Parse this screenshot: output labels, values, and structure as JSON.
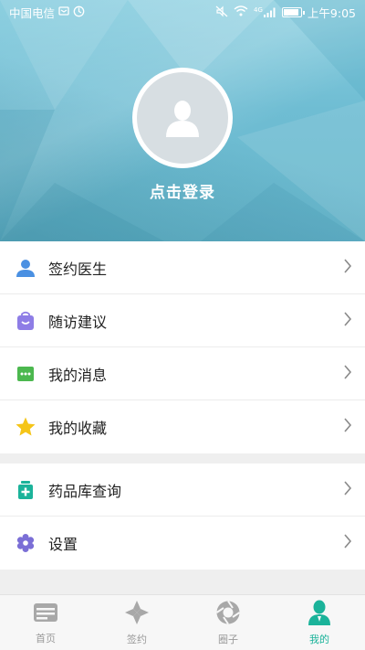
{
  "status_bar": {
    "carrier": "中国电信",
    "network": "4G",
    "time": "上午9:05"
  },
  "profile": {
    "avatar_icon": "user-silhouette-icon",
    "login_label": "点击登录"
  },
  "menu": {
    "group1": [
      {
        "label": "签约医生",
        "icon": "person-icon",
        "color": "#4a90e2"
      },
      {
        "label": "随访建议",
        "icon": "bag-icon",
        "color": "#8e7de6"
      },
      {
        "label": "我的消息",
        "icon": "message-icon",
        "color": "#4cb84f"
      },
      {
        "label": "我的收藏",
        "icon": "star-icon",
        "color": "#f5c518"
      }
    ],
    "group2": [
      {
        "label": "药品库查询",
        "icon": "medicine-icon",
        "color": "#1bb39a"
      },
      {
        "label": "设置",
        "icon": "gear-icon",
        "color": "#7b6fd6"
      }
    ]
  },
  "tabbar": {
    "tabs": [
      {
        "label": "首页",
        "icon": "home-icon",
        "active": false
      },
      {
        "label": "签约",
        "icon": "sign-icon",
        "active": false
      },
      {
        "label": "圈子",
        "icon": "circle-icon",
        "active": false
      },
      {
        "label": "我的",
        "icon": "profile-icon",
        "active": true
      }
    ],
    "active_color": "#1bb39a",
    "inactive_color": "#9a9a9a"
  }
}
